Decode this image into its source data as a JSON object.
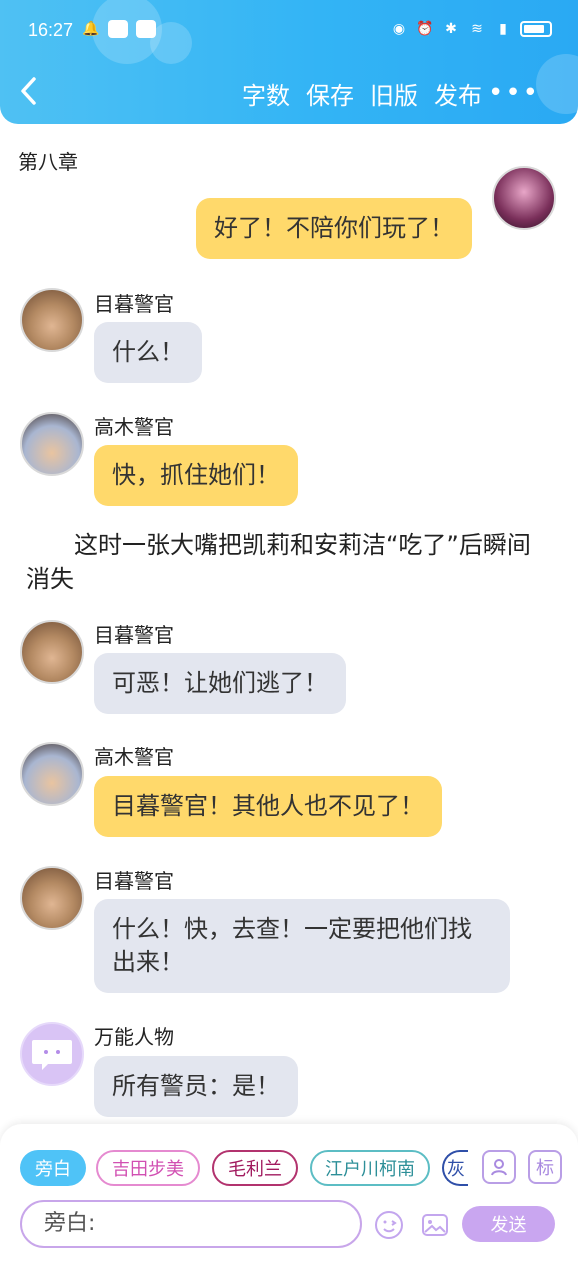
{
  "status_bar": {
    "time": "16:27",
    "icons_left": [
      "bell-icon",
      "app-badge-icon",
      "app-badge-icon"
    ],
    "icons_right": [
      "eye-icon",
      "alarm-icon",
      "bluetooth-icon",
      "wifi-icon",
      "signal-icon",
      "battery-icon"
    ]
  },
  "header": {
    "back_icon": "‹",
    "actions": [
      "字数",
      "保存",
      "旧版",
      "发布"
    ],
    "more_icon": "•••"
  },
  "chapter_title": "第八章",
  "messages": [
    {
      "side": "right",
      "text": "好了！不陪你们玩了！",
      "style": "yellow"
    },
    {
      "side": "left",
      "name": "目暮警官",
      "text": "什么！",
      "style": "gray"
    },
    {
      "side": "left",
      "name": "高木警官",
      "text": "快，抓住她们！",
      "style": "yellow"
    },
    {
      "side": "narration",
      "text": "这时一张大嘴把凯莉和安莉洁“吃了”后瞬间消失"
    },
    {
      "side": "left",
      "name": "目暮警官",
      "text": "可恶！让她们逃了！",
      "style": "gray"
    },
    {
      "side": "left",
      "name": "高木警官",
      "text": "目暮警官！其他人也不见了！",
      "style": "yellow"
    },
    {
      "side": "left",
      "name": "目暮警官",
      "text": "什么！快，去查！一定要把他们找出来！",
      "style": "gray"
    },
    {
      "side": "left",
      "name": "万能人物",
      "text": "所有警员：是！",
      "style": "gray"
    }
  ],
  "characters": [
    "旁白",
    "吉田步美",
    "毛利兰",
    "江户川柯南",
    "灰"
  ],
  "side_buttons": {
    "person": "person-icon",
    "tag": "标"
  },
  "input": {
    "value": "旁白:"
  },
  "send_label": "发送",
  "colors": {
    "header": "#2fb2f5",
    "yellow_bubble": "#ffd96b",
    "gray_bubble": "#e3e6ef",
    "send": "#c9a6f0"
  }
}
